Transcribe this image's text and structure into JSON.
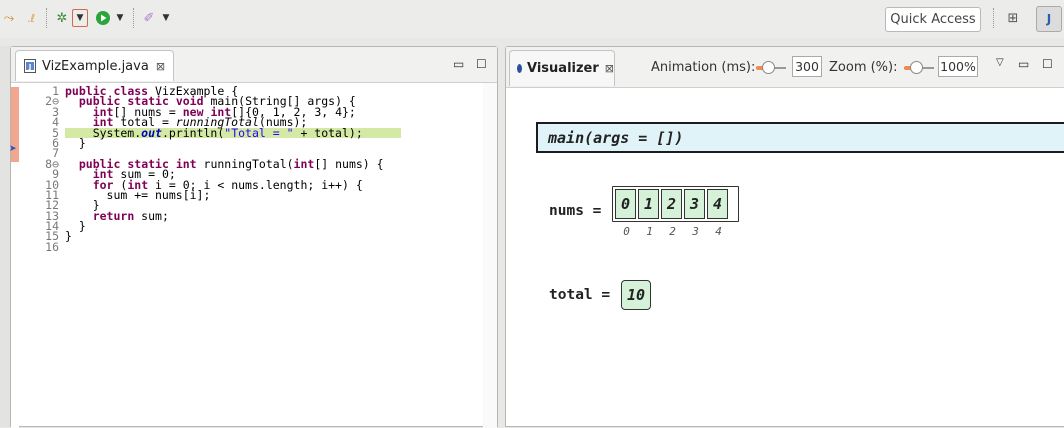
{
  "toolbar": {
    "quick_access": "Quick Access",
    "icons": [
      "run-history-icon",
      "bug-icon",
      "dropdown-icon",
      "run-icon",
      "dropdown-icon",
      "pen-icon",
      "dropdown-icon",
      "open-perspective-icon",
      "java-perspective-icon"
    ]
  },
  "editor": {
    "tab_label": "VizExample.java",
    "close_glyph": "⊠",
    "line_numbers": [
      "1",
      "2⊖",
      "3",
      "4",
      "5",
      "6",
      "7",
      "8⊖",
      "9",
      "10",
      "11",
      "12",
      "13",
      "14",
      "15",
      "16"
    ],
    "lines": [
      "public class VizExample {",
      "  public static void main(String[] args) {",
      "    int[] nums = new int[]{0, 1, 2, 3, 4};",
      "    int total = runningTotal(nums);",
      "    System.out.println(\"Total = \" + total);",
      "  }",
      "",
      "  public static int runningTotal(int[] nums) {",
      "    int sum = 0;",
      "    for (int i = 0; i < nums.length; i++) {",
      "      sum += nums[i];",
      "    }",
      "    return sum;",
      "  }",
      "}",
      ""
    ],
    "current_line": 5
  },
  "visualizer": {
    "tab_label": "Visualizer",
    "close_glyph": "⊠",
    "animation_label": "Animation (ms):",
    "animation_value": "300",
    "zoom_label": "Zoom (%):",
    "zoom_value": "100%",
    "frame": "main(args = [])",
    "nums_label": "nums =",
    "nums_values": [
      "0",
      "1",
      "2",
      "3",
      "4"
    ],
    "nums_indices": [
      "0",
      "1",
      "2",
      "3",
      "4"
    ],
    "total_label": "total =",
    "total_value": "10"
  },
  "colors": {
    "current_line": "#d4eaa4",
    "frame_bg": "#dff3f8",
    "cell_bg": "#d5f2d9",
    "keyword": "#7f0055",
    "string": "#2a00ff"
  }
}
